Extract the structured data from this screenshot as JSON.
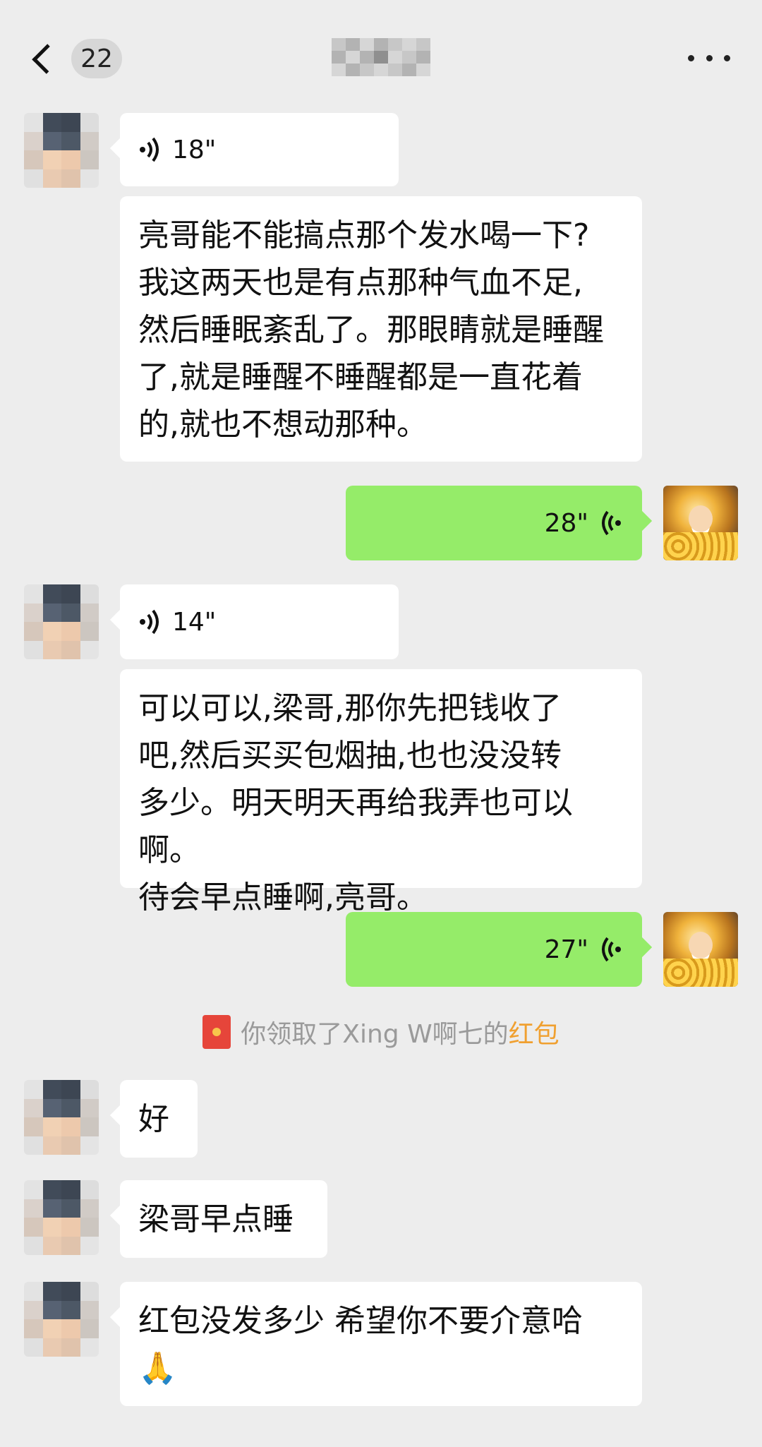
{
  "header": {
    "unread_count": "22"
  },
  "messages": [
    {
      "from": "other",
      "type": "voice",
      "duration": "18\""
    },
    {
      "from": "other",
      "type": "text",
      "lines": [
        "亮哥能不能搞点那个发水喝一下?",
        "我这两天也是有点那种气血不足,",
        "然后睡眠紊乱了。那眼睛就是睡醒",
        "了,就是睡醒不睡醒都是一直花着",
        "的,就也不想动那种。"
      ]
    },
    {
      "from": "me",
      "type": "voice",
      "duration": "28\""
    },
    {
      "from": "other",
      "type": "voice",
      "duration": "14\""
    },
    {
      "from": "other",
      "type": "text",
      "lines": [
        "可以可以,梁哥,那你先把钱收了",
        "吧,然后买买包烟抽,也也没没转",
        "多少。明天明天再给我弄也可以啊。",
        "待会早点睡啊,亮哥。"
      ]
    },
    {
      "from": "me",
      "type": "voice",
      "duration": "27\""
    },
    {
      "from": "other",
      "type": "text",
      "lines": [
        "好"
      ]
    },
    {
      "from": "other",
      "type": "text",
      "lines": [
        "梁哥早点睡"
      ]
    },
    {
      "from": "other",
      "type": "text",
      "lines": [
        "红包没发多少 希望你不要介意哈",
        "🙏"
      ]
    }
  ],
  "system_notice": {
    "prefix": "你领取了Xing W啊七的",
    "link": "红包"
  },
  "colors": {
    "background": "#ededed",
    "outgoing_bubble": "#95ec69",
    "incoming_bubble": "#ffffff",
    "red_packet": "#e6453a",
    "red_packet_link": "#f0a030"
  },
  "icons": [
    "back-chevron-icon",
    "more-icon",
    "voice-wave-icon",
    "red-packet-icon"
  ]
}
